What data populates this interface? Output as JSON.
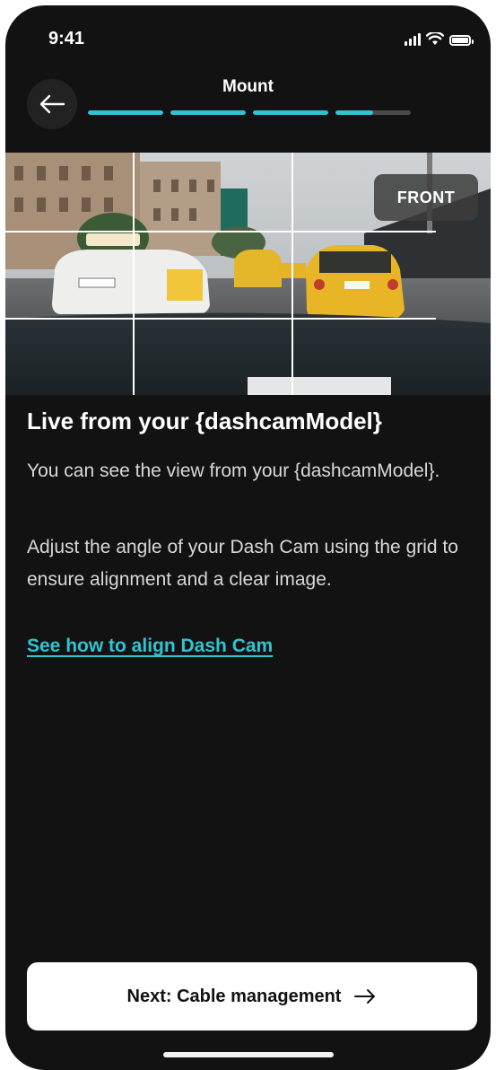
{
  "status_bar": {
    "time": "9:41",
    "signal_icon": "cellular-signal-icon",
    "wifi_icon": "wifi-icon",
    "battery_icon": "battery-icon"
  },
  "header": {
    "title": "Mount",
    "back_icon": "arrow-left-icon",
    "progress_segments": [
      1,
      1,
      1,
      0.5
    ],
    "accent_color": "#2fc4d2"
  },
  "camera": {
    "badge": "FRONT"
  },
  "content": {
    "title": "Live from your {dashcamModel}",
    "paragraph1": "You can see the view from your {dashcamModel}.",
    "paragraph2": "Adjust the angle of your Dash Cam using the grid to ensure alignment and a clear image.",
    "link": "See how to align Dash Cam"
  },
  "footer": {
    "next_label": "Next: Cable management",
    "next_icon": "arrow-right-icon"
  }
}
